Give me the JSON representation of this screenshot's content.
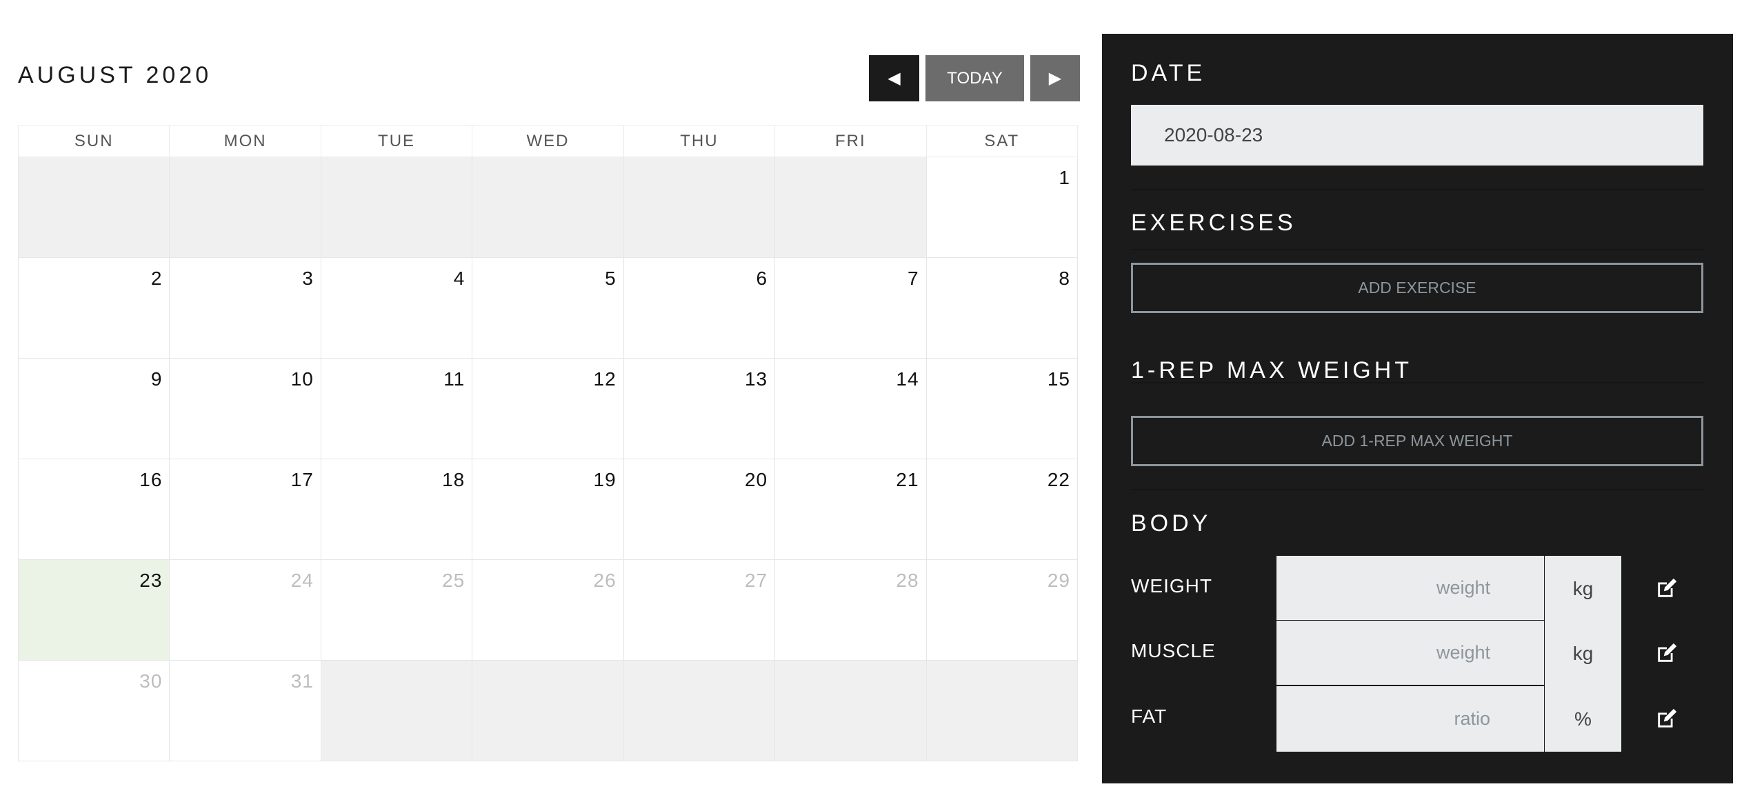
{
  "calendar": {
    "title": "AUGUST 2020",
    "nav": {
      "prev_icon": "caret-left-icon",
      "today_label": "TODAY",
      "next_icon": "caret-right-icon"
    },
    "weekdays": [
      "SUN",
      "MON",
      "TUE",
      "WED",
      "THU",
      "FRI",
      "SAT"
    ],
    "weeks": [
      [
        "",
        "",
        "",
        "",
        "",
        "",
        "1"
      ],
      [
        "2",
        "3",
        "4",
        "5",
        "6",
        "7",
        "8"
      ],
      [
        "9",
        "10",
        "11",
        "12",
        "13",
        "14",
        "15"
      ],
      [
        "16",
        "17",
        "18",
        "19",
        "20",
        "21",
        "22"
      ],
      [
        "23",
        "24",
        "25",
        "26",
        "27",
        "28",
        "29"
      ],
      [
        "30",
        "31",
        "",
        "",
        "",
        "",
        ""
      ]
    ],
    "selected_day": "23",
    "selected_color": "#ebf3e6"
  },
  "panel": {
    "date_heading": "DATE",
    "date_value": "2020-08-23",
    "exercises_heading": "EXERCISES",
    "add_exercise_label": "ADD EXERCISE",
    "one_rep_heading": "1-REP MAX WEIGHT",
    "add_one_rep_label": "ADD 1-REP MAX WEIGHT",
    "body_heading": "BODY",
    "body_rows": [
      {
        "label": "WEIGHT",
        "placeholder": "weight",
        "unit": "kg",
        "icon": "edit-icon"
      },
      {
        "label": "MUSCLE",
        "placeholder": "weight",
        "unit": "kg",
        "icon": "edit-icon"
      },
      {
        "label": "FAT",
        "placeholder": "ratio",
        "unit": "%",
        "icon": "edit-icon"
      }
    ]
  }
}
